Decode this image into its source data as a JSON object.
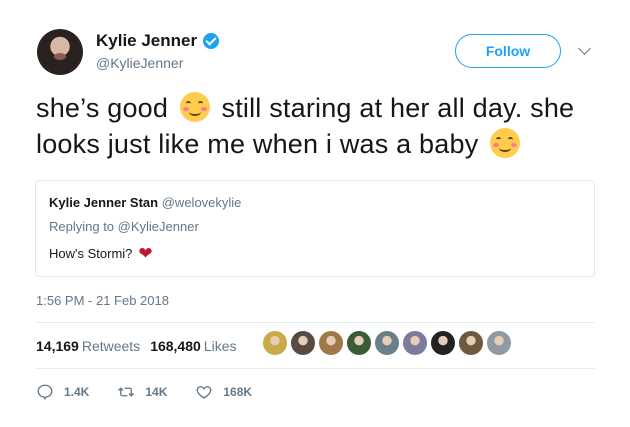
{
  "profile": {
    "name": "Kylie Jenner",
    "handle": "@KylieJenner"
  },
  "follow_button": "Follow",
  "tweet": {
    "part1": "she’s good",
    "part2": " still staring at her all day. she looks just like me when i was a baby",
    "emojis": [
      "smiling-face-with-smiling-eyes",
      "smiling-face-with-smiling-eyes"
    ]
  },
  "quoted_tweet": {
    "name": "Kylie Jenner Stan",
    "handle": "@welovekylie",
    "replying_to": "Replying to @KylieJenner",
    "text": "How's Stormi?",
    "emoji": "red-heart"
  },
  "timestamp": "1:56 PM - 21 Feb 2018",
  "stats": {
    "retweets_count": "14,169",
    "retweets_label": "Retweets",
    "likes_count": "168,480",
    "likes_label": "Likes"
  },
  "liker_avatars": [
    "#c9a94a",
    "#5a4a44",
    "#a07848",
    "#3b5a3a",
    "#6a7f8a",
    "#7d7a9e",
    "#222222",
    "#6b5a3d",
    "#8f9aa3"
  ],
  "actions": {
    "reply_count": "1.4K",
    "retweet_count": "14K",
    "like_count": "168K"
  },
  "colors": {
    "accent": "#1da1f2",
    "muted": "#657786",
    "text": "#14171a"
  }
}
